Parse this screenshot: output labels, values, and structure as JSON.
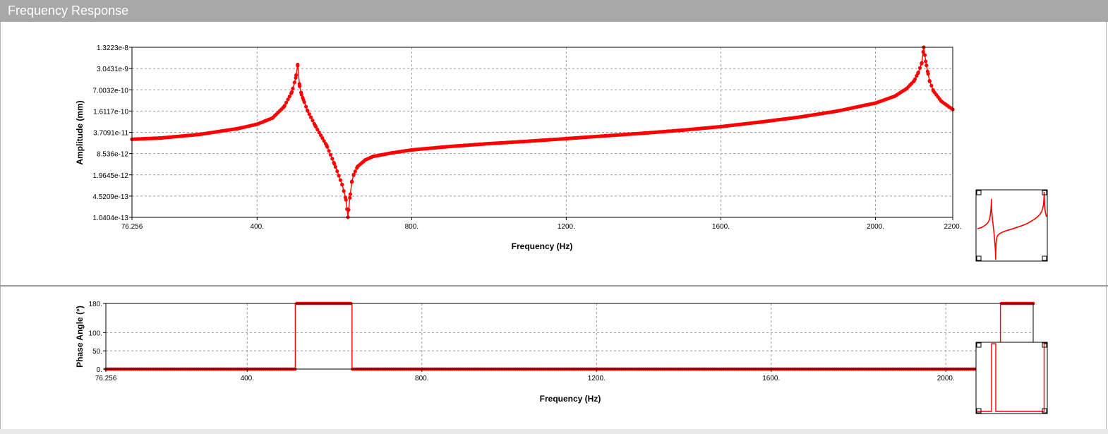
{
  "window": {
    "title": "Frequency Response"
  },
  "chart_data": [
    {
      "type": "line",
      "name": "amplitude",
      "xlabel": "Frequency (Hz)",
      "ylabel": "Amplitude (mm)",
      "xlim": [
        76.256,
        2200
      ],
      "y_scale": "log",
      "ylim": [
        1.0404e-13,
        1.3223e-08
      ],
      "x_ticks": [
        {
          "value": 76.256,
          "label": "76.256"
        },
        {
          "value": 400,
          "label": "400."
        },
        {
          "value": 800,
          "label": "800."
        },
        {
          "value": 1200,
          "label": "1200."
        },
        {
          "value": 1600,
          "label": "1600."
        },
        {
          "value": 2000,
          "label": "2000."
        },
        {
          "value": 2200,
          "label": "2200."
        }
      ],
      "y_ticks": [
        "1.3223e-8",
        "3.0431e-9",
        "7.0032e-10",
        "1.6117e-10",
        "3.7091e-11",
        "8.536e-12",
        "1.9645e-12",
        "4.5209e-13",
        "1.0404e-13"
      ],
      "grid": true,
      "color": "#ff0000",
      "series": [
        {
          "x": [
            76.256,
            150,
            250,
            350,
            400,
            440,
            470,
            490,
            500,
            505,
            510,
            515,
            520,
            530,
            550,
            580,
            600,
            620,
            630,
            635,
            640,
            645,
            650,
            660,
            680,
            700,
            750,
            800,
            900,
            1000,
            1100,
            1200,
            1300,
            1400,
            1500,
            1600,
            1700,
            1800,
            1900,
            2000,
            2050,
            2080,
            2100,
            2110,
            2120,
            2125,
            2130,
            2135,
            2140,
            2150,
            2170,
            2200
          ],
          "y": [
            2.3e-11,
            2.5e-11,
            3.2e-11,
            4.8e-11,
            6.5e-11,
            1e-10,
            2.2e-10,
            6e-10,
            1.6e-09,
            4e-09,
            9e-10,
            5e-10,
            3.5e-10,
            1.7e-10,
            6e-11,
            1.5e-11,
            4.2e-12,
            1e-12,
            3.5e-13,
            1.05e-13,
            4e-13,
            1.2e-12,
            2e-12,
            3.5e-12,
            5.5e-12,
            7e-12,
            9e-12,
            1.1e-11,
            1.4e-11,
            1.7e-11,
            2e-11,
            2.4e-11,
            2.9e-11,
            3.5e-11,
            4.3e-11,
            5.5e-11,
            7.5e-11,
            1.05e-10,
            1.6e-10,
            2.8e-10,
            4.5e-10,
            7.5e-10,
            1.3e-09,
            2.2e-09,
            4.5e-09,
            1.32e-08,
            5e-09,
            2.5e-09,
            1.3e-09,
            6.5e-10,
            3.2e-10,
            1.8e-10
          ]
        }
      ]
    },
    {
      "type": "line",
      "name": "phase",
      "xlabel": "Frequency (Hz)",
      "ylabel": "Phase Angle (°)",
      "xlim": [
        76.256,
        2200
      ],
      "ylim": [
        0,
        180
      ],
      "x_ticks": [
        {
          "value": 76.256,
          "label": "76.256"
        },
        {
          "value": 400,
          "label": "400."
        },
        {
          "value": 800,
          "label": "800."
        },
        {
          "value": 1200,
          "label": "1200."
        },
        {
          "value": 1600,
          "label": "1600."
        },
        {
          "value": 2000,
          "label": "2000."
        }
      ],
      "y_ticks": [
        {
          "value": 180,
          "label": "180."
        },
        {
          "value": 100,
          "label": "100."
        },
        {
          "value": 50,
          "label": "50."
        },
        {
          "value": 0,
          "label": "0."
        }
      ],
      "grid": true,
      "color": "#ff0000",
      "series": [
        {
          "x": [
            76.256,
            510,
            510,
            640,
            640,
            2125,
            2125,
            2200
          ],
          "y": [
            0,
            0,
            180,
            180,
            0,
            0,
            180,
            180
          ]
        }
      ]
    }
  ]
}
